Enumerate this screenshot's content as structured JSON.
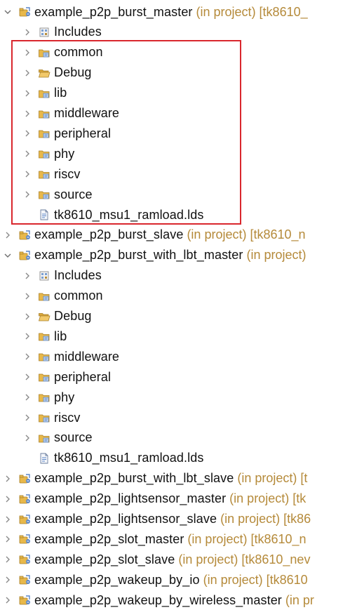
{
  "tree": {
    "projects": [
      {
        "name": "example_p2p_burst_master",
        "decoration": "(in project) [tk8610_",
        "expanded": true,
        "children": [
          {
            "label": "Includes",
            "kind": "includes"
          },
          {
            "label": "common",
            "kind": "src-folder"
          },
          {
            "label": "Debug",
            "kind": "open-folder"
          },
          {
            "label": "lib",
            "kind": "src-folder"
          },
          {
            "label": "middleware",
            "kind": "src-folder"
          },
          {
            "label": "peripheral",
            "kind": "src-folder"
          },
          {
            "label": "phy",
            "kind": "src-folder"
          },
          {
            "label": "riscv",
            "kind": "src-folder"
          },
          {
            "label": "source",
            "kind": "src-folder"
          },
          {
            "label": "tk8610_msu1_ramload.lds",
            "kind": "file"
          }
        ]
      },
      {
        "name": "example_p2p_burst_slave",
        "decoration": "(in project) [tk8610_n",
        "expanded": false
      },
      {
        "name": "example_p2p_burst_with_lbt_master",
        "decoration": "(in project)",
        "expanded": true,
        "children": [
          {
            "label": "Includes",
            "kind": "includes"
          },
          {
            "label": "common",
            "kind": "src-folder"
          },
          {
            "label": "Debug",
            "kind": "open-folder"
          },
          {
            "label": "lib",
            "kind": "src-folder"
          },
          {
            "label": "middleware",
            "kind": "src-folder"
          },
          {
            "label": "peripheral",
            "kind": "src-folder"
          },
          {
            "label": "phy",
            "kind": "src-folder"
          },
          {
            "label": "riscv",
            "kind": "src-folder"
          },
          {
            "label": "source",
            "kind": "src-folder"
          },
          {
            "label": "tk8610_msu1_ramload.lds",
            "kind": "file"
          }
        ]
      },
      {
        "name": "example_p2p_burst_with_lbt_slave",
        "decoration": "(in project) [t",
        "expanded": false
      },
      {
        "name": "example_p2p_lightsensor_master",
        "decoration": "(in project) [tk",
        "expanded": false
      },
      {
        "name": "example_p2p_lightsensor_slave",
        "decoration": "(in project) [tk86",
        "expanded": false
      },
      {
        "name": "example_p2p_slot_master",
        "decoration": "(in project) [tk8610_n",
        "expanded": false
      },
      {
        "name": "example_p2p_slot_slave",
        "decoration": "(in project) [tk8610_nev",
        "expanded": false
      },
      {
        "name": "example_p2p_wakeup_by_io",
        "decoration": "(in project) [tk8610",
        "expanded": false
      },
      {
        "name": "example_p2p_wakeup_by_wireless_master",
        "decoration": "(in pr",
        "expanded": false
      }
    ]
  },
  "colors": {
    "decoration": "#b58a3a",
    "highlight_box": "#d9272e",
    "twisty": "#7a7a7a",
    "folder": "#e8b84a",
    "package": "#d4a24c",
    "project_blue": "#5a86c8"
  },
  "icons": {
    "project": "java-project-icon",
    "includes": "includes-icon",
    "src-folder": "source-folder-icon",
    "open-folder": "open-folder-icon",
    "file": "linker-script-file-icon",
    "expanded": "chevron-down-icon",
    "collapsed": "chevron-right-icon"
  }
}
